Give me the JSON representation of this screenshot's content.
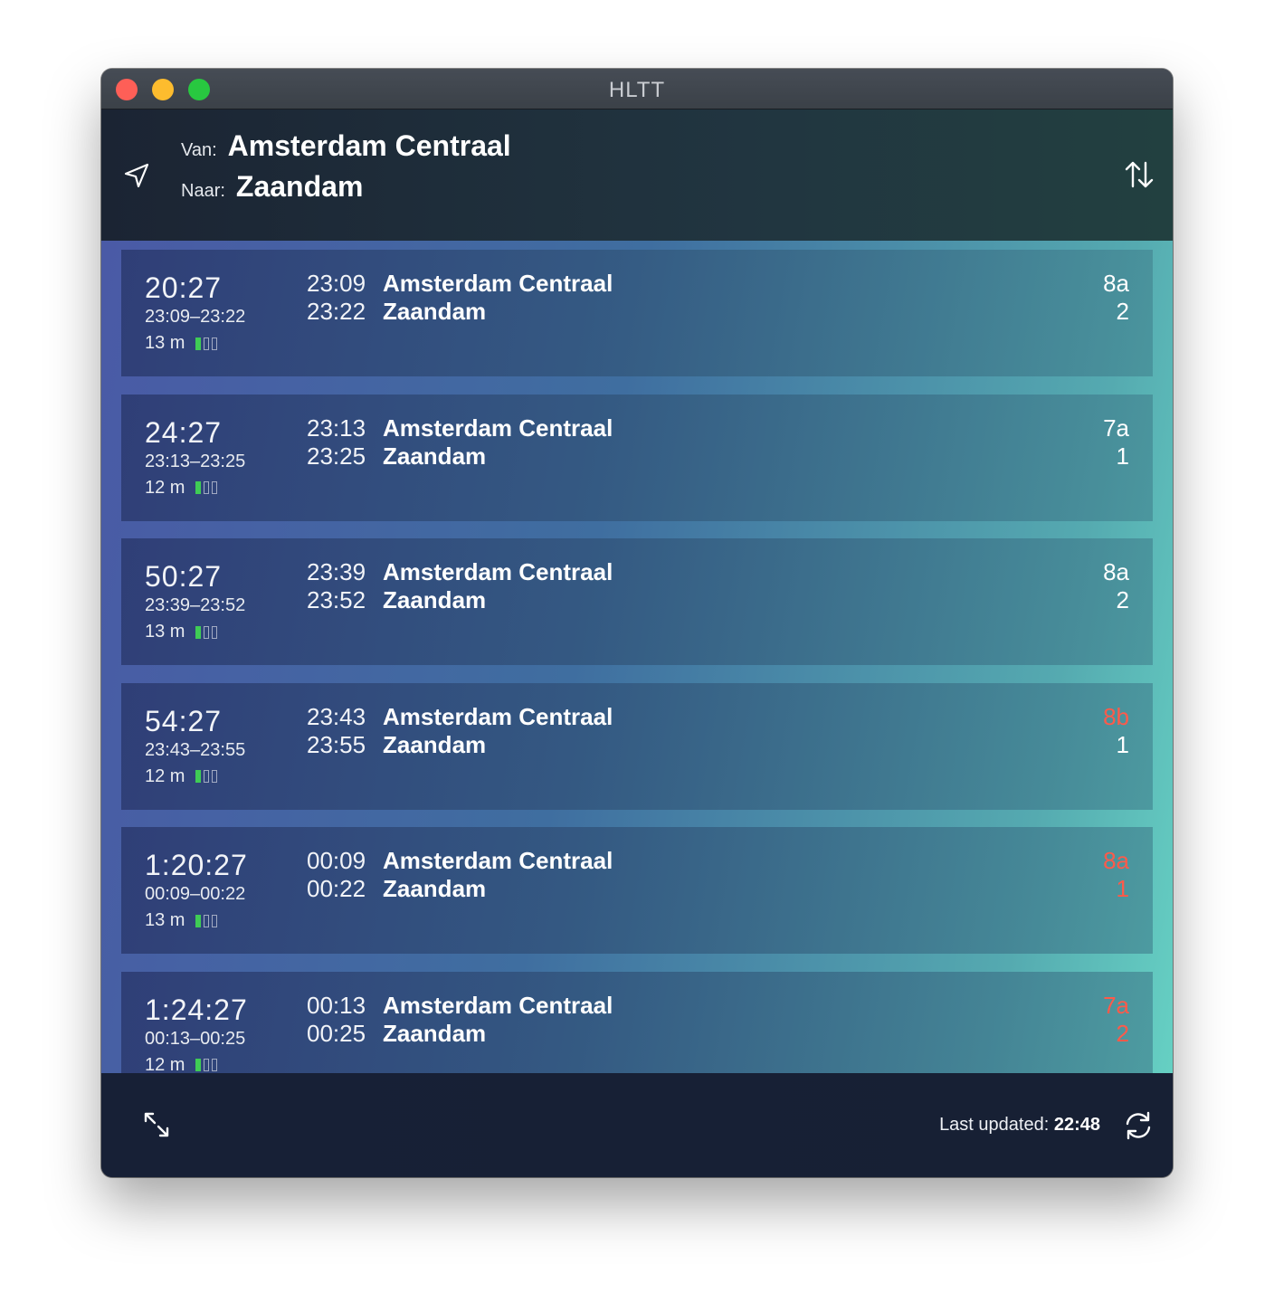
{
  "window": {
    "title": "HLTT"
  },
  "route": {
    "from_label": "Van:",
    "from_value": "Amsterdam Centraal",
    "to_label": "Naar:",
    "to_value": "Zaandam"
  },
  "trips": [
    {
      "countdown": "20:27",
      "span": "23:09–23:22",
      "duration": "13 m",
      "crowding_level": 1,
      "depart_time": "23:09",
      "depart_station": "Amsterdam Centraal",
      "arrive_time": "23:22",
      "arrive_station": "Zaandam",
      "depart_platform": "8a",
      "arrive_platform": "2",
      "depart_platform_changed": false,
      "arrive_platform_changed": false
    },
    {
      "countdown": "24:27",
      "span": "23:13–23:25",
      "duration": "12 m",
      "crowding_level": 1,
      "depart_time": "23:13",
      "depart_station": "Amsterdam Centraal",
      "arrive_time": "23:25",
      "arrive_station": "Zaandam",
      "depart_platform": "7a",
      "arrive_platform": "1",
      "depart_platform_changed": false,
      "arrive_platform_changed": false
    },
    {
      "countdown": "50:27",
      "span": "23:39–23:52",
      "duration": "13 m",
      "crowding_level": 1,
      "depart_time": "23:39",
      "depart_station": "Amsterdam Centraal",
      "arrive_time": "23:52",
      "arrive_station": "Zaandam",
      "depart_platform": "8a",
      "arrive_platform": "2",
      "depart_platform_changed": false,
      "arrive_platform_changed": false
    },
    {
      "countdown": "54:27",
      "span": "23:43–23:55",
      "duration": "12 m",
      "crowding_level": 1,
      "depart_time": "23:43",
      "depart_station": "Amsterdam Centraal",
      "arrive_time": "23:55",
      "arrive_station": "Zaandam",
      "depart_platform": "8b",
      "arrive_platform": "1",
      "depart_platform_changed": true,
      "arrive_platform_changed": false
    },
    {
      "countdown": "1:20:27",
      "span": "00:09–00:22",
      "duration": "13 m",
      "crowding_level": 1,
      "depart_time": "00:09",
      "depart_station": "Amsterdam Centraal",
      "arrive_time": "00:22",
      "arrive_station": "Zaandam",
      "depart_platform": "8a",
      "arrive_platform": "1",
      "depart_platform_changed": true,
      "arrive_platform_changed": true
    },
    {
      "countdown": "1:24:27",
      "span": "00:13–00:25",
      "duration": "12 m",
      "crowding_level": 1,
      "depart_time": "00:13",
      "depart_station": "Amsterdam Centraal",
      "arrive_time": "00:25",
      "arrive_station": "Zaandam",
      "depart_platform": "7a",
      "arrive_platform": "2",
      "depart_platform_changed": true,
      "arrive_platform_changed": true
    }
  ],
  "footer": {
    "updated_label": "Last updated:",
    "updated_time": "22:48"
  },
  "colors": {
    "platform_changed": "#ff5a4a",
    "crowding_on": "#3fcc55"
  },
  "icons": {
    "location": "location-arrow-icon",
    "swap": "swap-direction-icon",
    "expand": "expand-icon",
    "refresh": "refresh-icon"
  }
}
